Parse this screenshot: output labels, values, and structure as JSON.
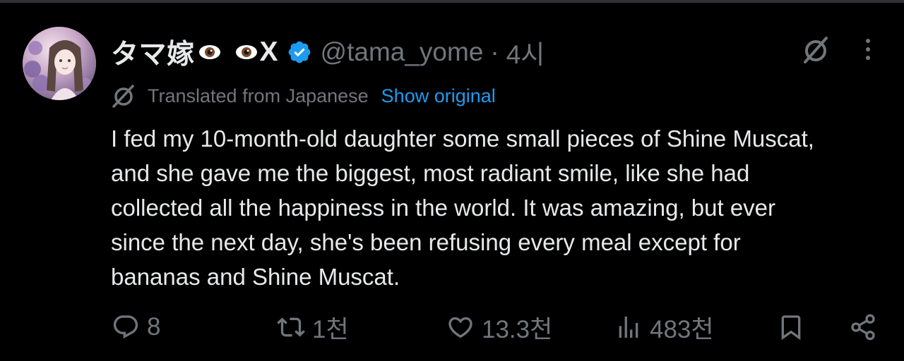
{
  "tweet": {
    "author": {
      "display_name": "タマ嫁",
      "display_name_suffix": "X",
      "handle": "@tama_yome",
      "verified": true,
      "avatar_icon": "avatar"
    },
    "separator": "·",
    "time": "4시",
    "translation": {
      "label": "Translated from Japanese",
      "show_original_label": "Show original"
    },
    "text_lines": [
      "I fed my 10-month-old daughter some small pieces of Shine Muscat,",
      "and she gave me the biggest, most radiant smile, like she had",
      "collected all the happiness in the world. It was amazing, but ever",
      "since the next day, she's been refusing every meal except for",
      "bananas and Shine Muscat."
    ],
    "actions": {
      "reply_count": "8",
      "repost_count": "1천",
      "like_count": "13.3천",
      "views_count": "483천"
    }
  },
  "icons": {
    "verified": "verified-badge-icon",
    "grok": "grok-icon",
    "more": "more-options-icon",
    "reply": "reply-icon",
    "repost": "repost-icon",
    "like": "like-icon",
    "views": "views-icon",
    "bookmark": "bookmark-icon",
    "share": "share-icon"
  },
  "colors": {
    "background": "#000000",
    "primary_text": "#e7e9ea",
    "secondary_text": "#71767b",
    "accent": "#1d9bf0",
    "divider": "#2f3336"
  }
}
